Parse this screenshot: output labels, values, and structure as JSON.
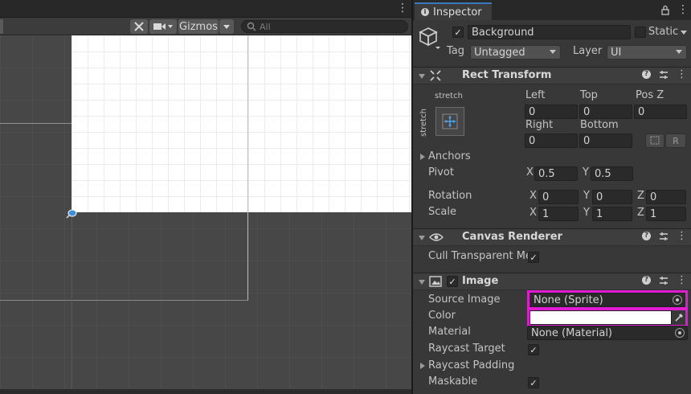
{
  "scene": {
    "toolbar": {
      "gizmos_label": "Gizmos",
      "search_placeholder": "All",
      "more_icon": "⋮"
    }
  },
  "inspector": {
    "tab_label": "Inspector",
    "game_object": {
      "active": true,
      "name": "Background",
      "static_label": "Static",
      "tag_label": "Tag",
      "tag_value": "Untagged",
      "layer_label": "Layer",
      "layer_value": "UI"
    },
    "rect_transform": {
      "title": "Rect Transform",
      "anchor_preset_h": "stretch",
      "anchor_preset_v": "stretch",
      "left_label": "Left",
      "left_value": "0",
      "top_label": "Top",
      "top_value": "0",
      "posz_label": "Pos Z",
      "posz_value": "0",
      "right_label": "Right",
      "right_value": "0",
      "bottom_label": "Bottom",
      "bottom_value": "0",
      "raw_edit_label": "R",
      "anchors_label": "Anchors",
      "pivot_label": "Pivot",
      "pivot_x": "0.5",
      "pivot_y": "0.5",
      "rotation_label": "Rotation",
      "rotation_x": "0",
      "rotation_y": "0",
      "rotation_z": "0",
      "scale_label": "Scale",
      "scale_x": "1",
      "scale_y": "1",
      "scale_z": "1",
      "axis_x": "X",
      "axis_y": "Y",
      "axis_z": "Z"
    },
    "canvas_renderer": {
      "title": "Canvas Renderer",
      "cull_label": "Cull Transparent Me",
      "cull_checked": true
    },
    "image": {
      "title": "Image",
      "enabled": true,
      "source_image_label": "Source Image",
      "source_image_value": "None (Sprite)",
      "color_label": "Color",
      "color_value": "#ffffff",
      "material_label": "Material",
      "material_value": "None (Material)",
      "raycast_target_label": "Raycast Target",
      "raycast_target_checked": true,
      "raycast_padding_label": "Raycast Padding",
      "maskable_label": "Maskable",
      "maskable_checked": true
    },
    "check_glyph": "✓"
  },
  "colors": {
    "highlight": "#e21ad1",
    "tab_accent": "#3a79bb",
    "panel_bg": "#383838",
    "scene_bg": "#474747"
  }
}
